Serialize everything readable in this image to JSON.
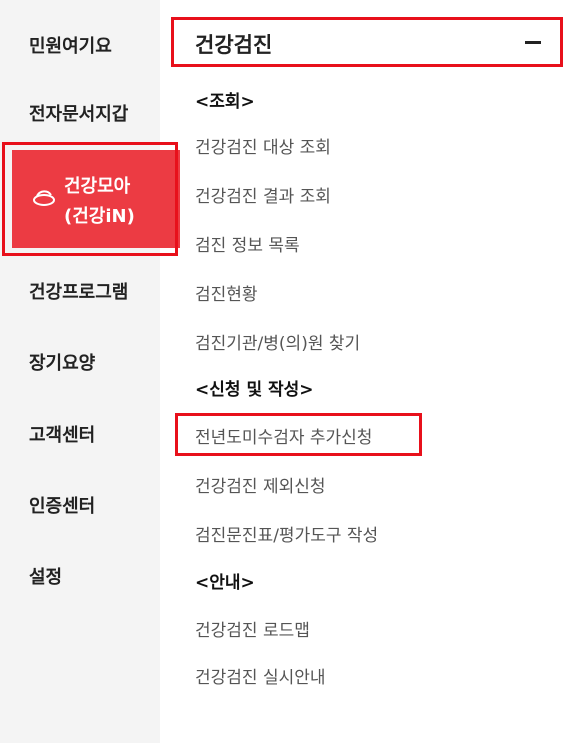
{
  "sidebar": {
    "items": [
      {
        "label": "민원여기요"
      },
      {
        "label": "전자문서지갑"
      },
      {
        "label_line1": "건강모아",
        "label_line2": "(건강iN)",
        "icon": "health-bowl-icon",
        "active": true
      },
      {
        "label": "건강프로그램"
      },
      {
        "label": "장기요양"
      },
      {
        "label": "고객센터"
      },
      {
        "label": "인증센터"
      },
      {
        "label": "설정"
      }
    ]
  },
  "main": {
    "title": "건강검진",
    "collapse_icon": "minus-icon",
    "sections": [
      {
        "heading": "<조회>",
        "links": [
          "건강검진 대상 조회",
          "건강검진 결과 조회",
          "검진 정보 목록",
          "검진현황",
          "검진기관/병(의)원 찾기"
        ]
      },
      {
        "heading": "<신청 및 작성>",
        "links": [
          "전년도미수검자 추가신청",
          "건강검진 제외신청",
          "검진문진표/평가도구 작성"
        ]
      },
      {
        "heading": "<안내>",
        "links": [
          "건강검진 로드맵",
          "건강검진 실시안내"
        ]
      }
    ],
    "highlighted_link": "전년도미수검자 추가신청"
  },
  "colors": {
    "accent": "#ec3b43",
    "highlight_border": "#e8101b",
    "sidebar_bg": "#f4f4f4"
  }
}
